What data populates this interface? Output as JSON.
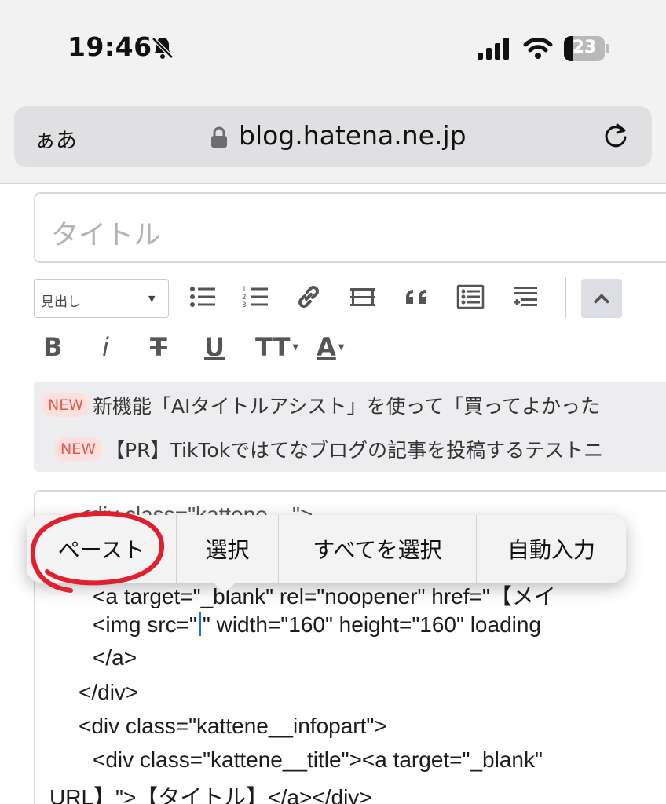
{
  "status_bar": {
    "time": "19:46",
    "battery_percent": "23",
    "icons": [
      "bell-slash-icon",
      "cellular-signal-icon",
      "wifi-icon",
      "battery-icon"
    ]
  },
  "browser": {
    "text_size_button": "ぁあ",
    "url": "blog.hatena.ne.jp",
    "icons": [
      "lock-icon",
      "reload-icon"
    ]
  },
  "editor": {
    "title_placeholder": "タイトル",
    "heading_select": "見出し",
    "toolbar_icons": [
      "bulleted-list-icon",
      "numbered-list-icon",
      "link-icon",
      "table-icon",
      "quote-icon",
      "definition-list-icon",
      "insert-more-icon",
      "collapse-icon"
    ],
    "format": {
      "bold": "B",
      "italic": "i",
      "strike": "T",
      "underline": "U",
      "size": "TT",
      "color": "A"
    }
  },
  "notices": [
    {
      "badge": "NEW",
      "text": "新機能「AIタイトルアシスト」を使って「買ってよかった"
    },
    {
      "badge": "NEW",
      "text": "【PR】TikTokではてなブログの記事を投稿するテストニ"
    }
  ],
  "code_lines": [
    "<div class=\"kattene__\">",
    "<a target=\"_blank\" rel=\"noopener\" href=\"【メイ",
    "<img src=\"",
    "\" width=\"160\" height=\"160\" loading",
    "</a>",
    "</div>",
    "<div class=\"kattene__infopart\">",
    "<div class=\"kattene__title\"><a target=\"_blank\"",
    "URL】\">【タイトル】</a></div>"
  ],
  "context_menu": {
    "items": [
      "ペースト",
      "選択",
      "すべてを選択",
      "自動入力"
    ],
    "highlight_color": "#e0202e"
  }
}
